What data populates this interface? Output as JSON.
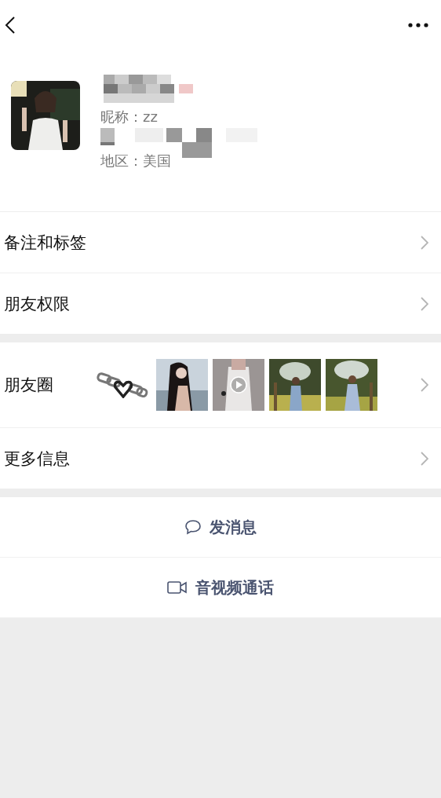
{
  "profile": {
    "nickname": "昵称：zz",
    "region": "地区：美国"
  },
  "rows": [
    {
      "label": "备注和标签",
      "kind": "plain",
      "gap_after": false
    },
    {
      "label": "朋友权限",
      "kind": "plain",
      "gap_after": true
    },
    {
      "label": "朋友圈",
      "kind": "moments",
      "gap_after": false,
      "photos": [
        {
          "video": false
        },
        {
          "video": true
        },
        {
          "video": false
        },
        {
          "video": false
        }
      ]
    },
    {
      "label": "更多信息",
      "kind": "plain",
      "gap_after": true
    }
  ],
  "actions": [
    {
      "label": "发消息",
      "kind": "message"
    },
    {
      "label": "音视频通话",
      "kind": "call"
    }
  ]
}
